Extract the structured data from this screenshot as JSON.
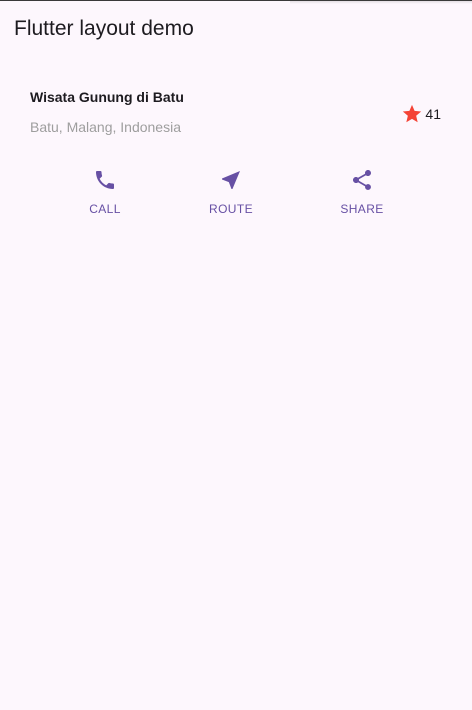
{
  "app_bar": {
    "title": "Flutter layout demo"
  },
  "title_section": {
    "name": "Wisata Gunung di Batu",
    "location": "Batu, Malang, Indonesia",
    "rating_count": "41"
  },
  "buttons": [
    {
      "label": "CALL",
      "icon": "phone-icon"
    },
    {
      "label": "ROUTE",
      "icon": "navigation-icon"
    },
    {
      "label": "SHARE",
      "icon": "share-icon"
    }
  ],
  "colors": {
    "background": "#fdf7fd",
    "primary": "#6750a4",
    "star": "#f44336",
    "secondary_text": "#9e9e9e"
  }
}
